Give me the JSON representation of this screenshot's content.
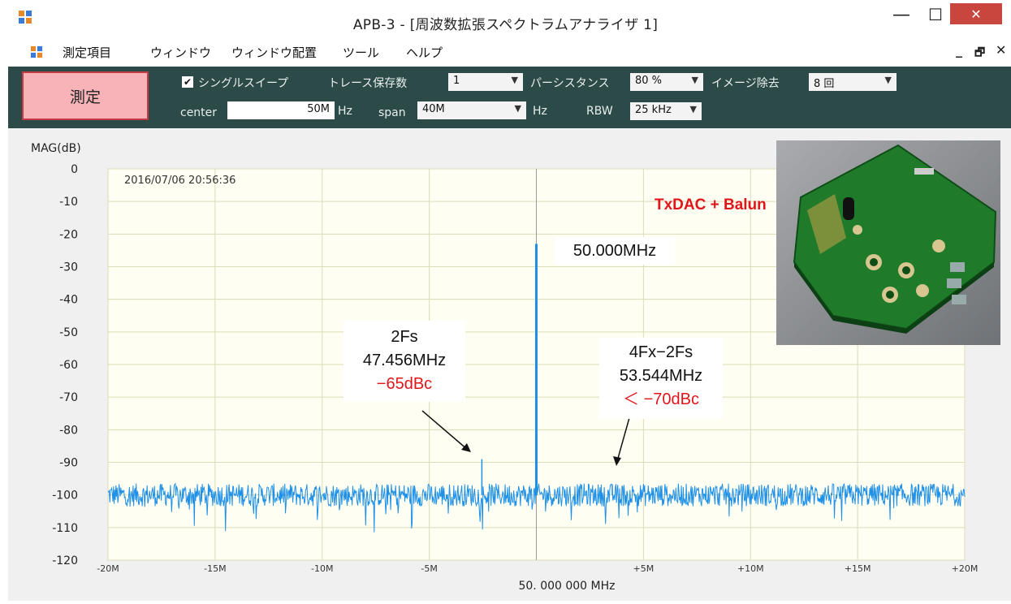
{
  "window": {
    "title": "APB-3 - [周波数拡張スペクトラムアナライザ 1]",
    "minimize": "—",
    "maximize": "☐",
    "close": "✕"
  },
  "menu": {
    "items": [
      "測定項目",
      "ウィンドウ",
      "ウィンドウ配置",
      "ツール",
      "ヘルプ"
    ],
    "mdi_minimize": "_",
    "mdi_restore": "🗗",
    "mdi_close": "✕"
  },
  "toolbar": {
    "measure_label": "測定",
    "single_sweep_label": "シングルスイープ",
    "single_sweep_checked": true,
    "trace_save_label": "トレース保存数",
    "trace_save_value": "1",
    "persistence_label": "パーシスタンス",
    "persistence_value": "80 %",
    "image_reject_label": "イメージ除去",
    "image_reject_value": "8 回",
    "center_label": "center",
    "center_value": "50M",
    "center_unit": "Hz",
    "span_label": "span",
    "span_value": "40M",
    "span_unit": "Hz",
    "rbw_label": "RBW",
    "rbw_value": "25 kHz"
  },
  "chart_data": {
    "type": "line",
    "ylabel": "MAG(dB)",
    "xlabel": "50. 000 000 MHz",
    "timestamp": "2016/07/06 20:56:36",
    "xlim": [
      -20,
      20
    ],
    "ylim": [
      -120,
      0
    ],
    "x_unit": "MHz offset from center",
    "x_ticks": [
      -20,
      -15,
      -10,
      -5,
      0,
      5,
      10,
      15,
      20
    ],
    "x_tick_labels": [
      "-20M",
      "-15M",
      "-10M",
      "-5M",
      "",
      "+5M",
      "+10M",
      "+15M",
      "+20M"
    ],
    "y_ticks": [
      0,
      -10,
      -20,
      -30,
      -40,
      -50,
      -60,
      -70,
      -80,
      -90,
      -100,
      -110,
      -120
    ],
    "y_tick_labels": [
      "0",
      "-10",
      "-20",
      "-30",
      "-40",
      "-50",
      "-60",
      "-70",
      "-80",
      "-90",
      "-100",
      "-110",
      "-120"
    ],
    "grid": true,
    "noise_floor_db": -100,
    "series_color": "#1e90e8",
    "peaks": [
      {
        "x": 0,
        "y": -23
      },
      {
        "x": -2.544,
        "y": -89
      },
      {
        "x": 3.544,
        "y": -97
      }
    ]
  },
  "annotations": {
    "carrier": "50.000MHz",
    "spur1_name": "2Fs",
    "spur1_freq": "47.456MHz",
    "spur1_level": "−65dBc",
    "spur2_name": "4Fx−2Fs",
    "spur2_freq": "53.544MHz",
    "spur2_level": "＜ −70dBc",
    "photo_label": "TxDAC + Balun"
  },
  "colors": {
    "toolbar_bg": "#2c4a47",
    "plot_bg": "#fefef2",
    "trace": "#1e90e8",
    "annotation_red": "#e0161b",
    "measure_button_bg": "#f7b3b8"
  }
}
